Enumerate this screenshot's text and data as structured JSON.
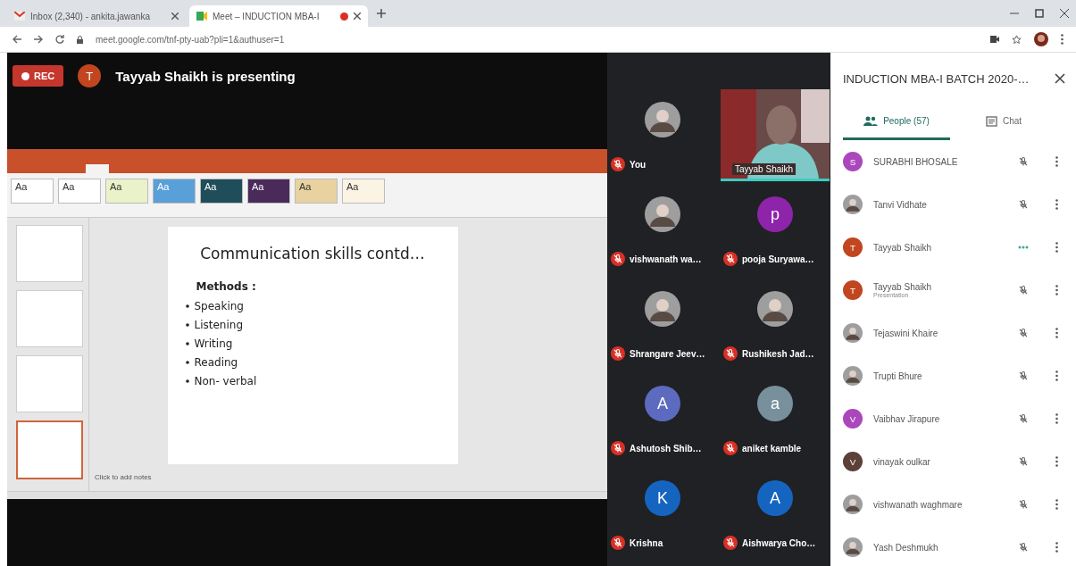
{
  "browser": {
    "tabs": [
      {
        "kind": "mail",
        "title": "Inbox (2,340) - ankita.jawanka",
        "selected": false,
        "recording": false
      },
      {
        "kind": "meet",
        "title": "Meet – INDUCTION MBA-I",
        "selected": true,
        "recording": true
      }
    ],
    "url": "meet.google.com/tnf-pty-uab?pli=1&authuser=1"
  },
  "meet": {
    "rec_label": "REC",
    "presenter": {
      "initial": "T",
      "color": "#c1461f",
      "text": "Tayyab Shaikh is presenting"
    }
  },
  "presentation": {
    "themes": [
      {
        "label": "Aa",
        "color": "#ffffff"
      },
      {
        "label": "Aa",
        "color": "#ffffff"
      },
      {
        "label": "Aa",
        "color": "#e9f2c8"
      },
      {
        "label": "Aa",
        "color": "#5aa0d8"
      },
      {
        "label": "Aa",
        "color": "#1f4e5a"
      },
      {
        "label": "Aa",
        "color": "#4a2a5a"
      },
      {
        "label": "Aa",
        "color": "#e8d2a0"
      },
      {
        "label": "Aa",
        "color": "#fbf4e4"
      }
    ],
    "thumbnails": [
      {
        "selected": false
      },
      {
        "selected": false
      },
      {
        "selected": false
      },
      {
        "selected": true
      }
    ],
    "slide": {
      "title": "Communication skills contd…",
      "heading": "Methods :",
      "bullets": [
        "Speaking",
        "Listening",
        "Writing",
        "Reading",
        "Non- verbal"
      ]
    },
    "notes_placeholder": "Click to add notes"
  },
  "tiles": [
    {
      "name": "You",
      "muted": true
    },
    {
      "kind": "video",
      "name": "Tayyab Shaikh"
    },
    {
      "name": "vishwanath wa…",
      "muted": true
    },
    {
      "kind": "initial",
      "initial": "p",
      "color": "#8e24aa",
      "name": "pooja Suryawa…",
      "muted": true
    },
    {
      "name": "Shrangare Jeev…",
      "muted": true
    },
    {
      "name": "Rushikesh Jad…",
      "muted": true
    },
    {
      "kind": "initial",
      "initial": "A",
      "color": "#5c6bc0",
      "name": "Ashutosh Shib…",
      "muted": true
    },
    {
      "kind": "initial",
      "initial": "a",
      "color": "#78909c",
      "name": "aniket kamble",
      "muted": true
    },
    {
      "kind": "initial",
      "initial": "K",
      "color": "#1565c0",
      "name": "Krishna",
      "muted": true
    },
    {
      "kind": "initial",
      "initial": "A",
      "color": "#1565c0",
      "name": "Aishwarya Cho…",
      "muted": true
    }
  ],
  "sidebar": {
    "title": "INDUCTION MBA-I BATCH 2020-…",
    "tabs": [
      {
        "kind": "people",
        "label": "People (57)",
        "selected": true
      },
      {
        "kind": "chat",
        "label": "Chat",
        "selected": false
      }
    ],
    "participants": [
      {
        "kind": "initial",
        "initial": "S",
        "color": "#ab47bc",
        "name": "SURABHI BHOSALE",
        "muted": true
      },
      {
        "name": "Tanvi Vidhate",
        "muted": true
      },
      {
        "kind": "initial",
        "initial": "T",
        "color": "#c1461f",
        "name": "Tayyab Shaikh",
        "muted": false
      },
      {
        "kind": "initial",
        "initial": "T",
        "color": "#c1461f",
        "name": "Tayyab Shaikh",
        "subtitle": "Presentation",
        "muted": true
      },
      {
        "name": "Tejaswini Khaire",
        "muted": true
      },
      {
        "name": "Trupti Bhure",
        "muted": true
      },
      {
        "kind": "initial",
        "initial": "V",
        "color": "#ab47bc",
        "name": "Vaibhav Jirapure",
        "muted": true
      },
      {
        "kind": "initial",
        "initial": "V",
        "color": "#5d4037",
        "name": "vinayak oulkar",
        "muted": true
      },
      {
        "name": "vishwanath waghmare",
        "muted": true
      },
      {
        "name": "Yash Deshmukh",
        "muted": true
      }
    ]
  }
}
